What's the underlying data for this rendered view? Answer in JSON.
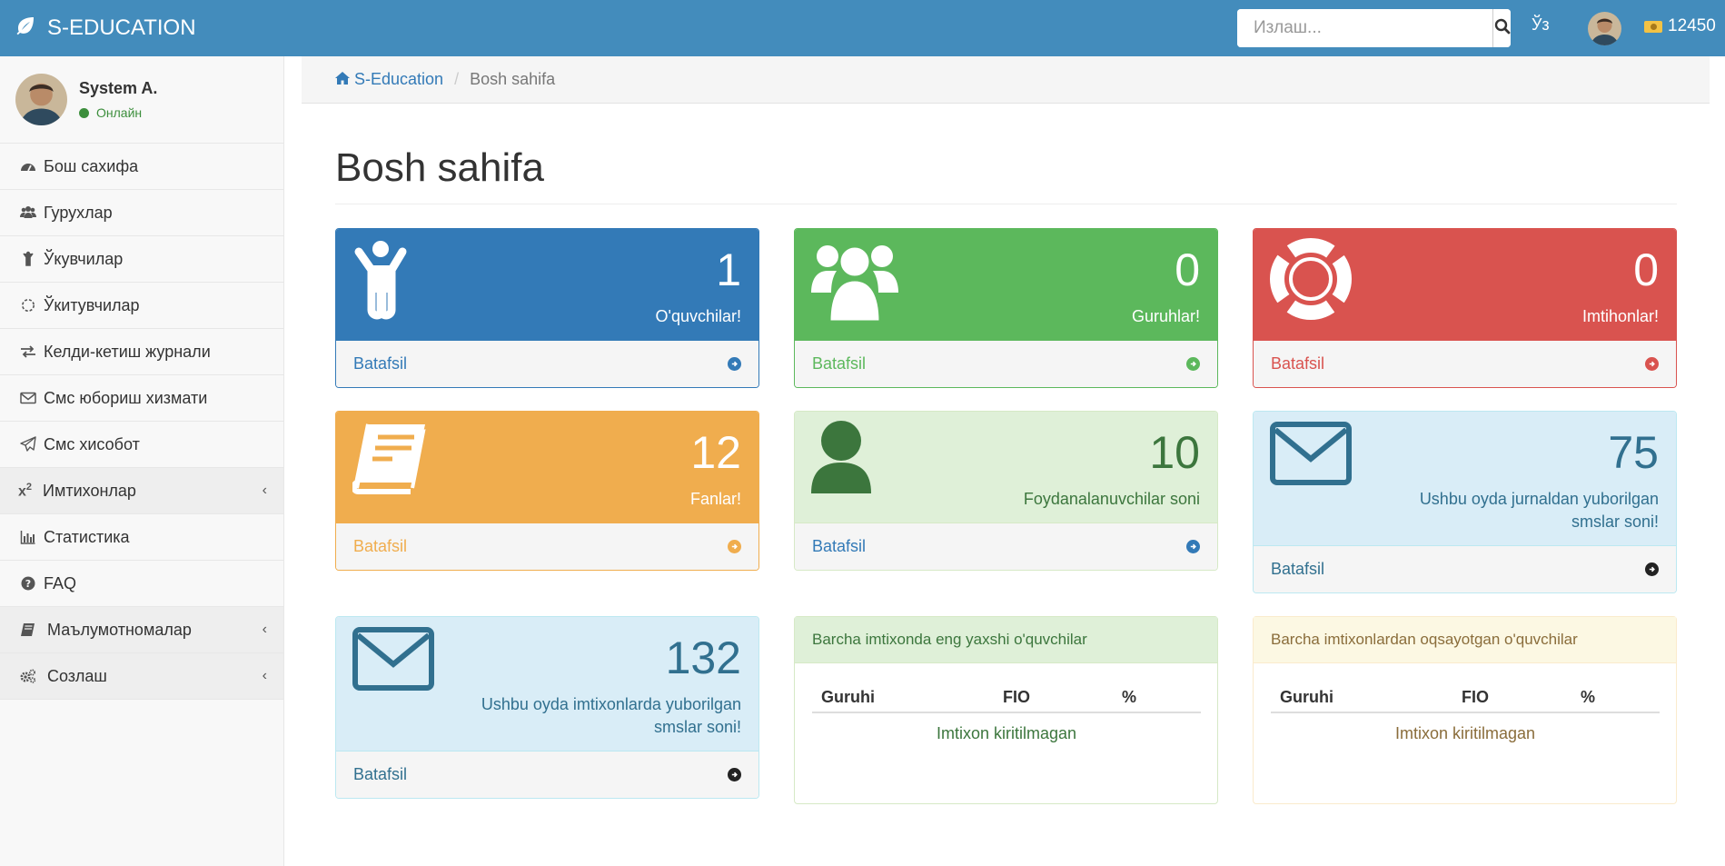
{
  "brand": {
    "name": "S-EDUCATION"
  },
  "header": {
    "search_placeholder": "Излаш...",
    "lang": "Ўз",
    "balance": "12450"
  },
  "user": {
    "name": "System A.",
    "status": "Онлайн"
  },
  "sidebar": {
    "items": [
      {
        "label": "Бош сахифа",
        "icon": "dashboard-icon"
      },
      {
        "label": "Гурухлар",
        "icon": "users-icon"
      },
      {
        "label": "Ўкувчилар",
        "icon": "child-icon"
      },
      {
        "label": "Ўкитувчилар",
        "icon": "spinner-icon"
      },
      {
        "label": "Келди-кетиш журнали",
        "icon": "exchange-icon"
      },
      {
        "label": "Смс юбориш хизмати",
        "icon": "envelope-icon"
      },
      {
        "label": "Смс хисобот",
        "icon": "paper-plane-icon"
      },
      {
        "label": "Имтихонлар",
        "icon": "superscript-icon",
        "expandable": true
      },
      {
        "label": "Статистика",
        "icon": "bar-chart-icon"
      },
      {
        "label": "FAQ",
        "icon": "question-circle-icon"
      },
      {
        "label": "Маълумотномалар",
        "icon": "book-icon",
        "expandable": true
      },
      {
        "label": "Созлаш",
        "icon": "cogs-icon",
        "expandable": true
      }
    ]
  },
  "breadcrumb": {
    "home": "S-Education",
    "current": "Bosh sahifa"
  },
  "page": {
    "title": "Bosh sahifa"
  },
  "cards": [
    {
      "value": "1",
      "label": "O'quvchilar!",
      "link": "Batafsil",
      "icon": "child-icon",
      "color": "#337ab7"
    },
    {
      "value": "0",
      "label": "Guruhlar!",
      "link": "Batafsil",
      "icon": "users-icon",
      "color": "#5cb85c"
    },
    {
      "value": "0",
      "label": "Imtihonlar!",
      "link": "Batafsil",
      "icon": "life-ring-icon",
      "color": "#d9534f"
    },
    {
      "value": "12",
      "label": "Fanlar!",
      "link": "Batafsil",
      "icon": "book-icon",
      "color": "#f0ad4e"
    },
    {
      "value": "10",
      "label": "Foydanalanuvchilar soni",
      "link": "Batafsil",
      "icon": "user-icon",
      "color": "#dff0d8"
    },
    {
      "value": "75",
      "label": "Ushbu oyda jurnaldan yuborilgan smslar soni!",
      "link": "Batafsil",
      "icon": "envelope-icon",
      "color": "#d9edf7"
    },
    {
      "value": "132",
      "label": "Ushbu oyda imtixonlarda yuborilgan smslar soni!",
      "link": "Batafsil",
      "icon": "envelope-icon",
      "color": "#d9edf7"
    }
  ],
  "tables": [
    {
      "title": "Barcha imtixonda eng yaxshi o'quvchilar",
      "columns": [
        "Guruhi",
        "FIO",
        "%"
      ],
      "empty": "Imtixon kiritilmagan"
    },
    {
      "title": "Barcha imtixonlardan oqsayotgan o'quvchilar",
      "columns": [
        "Guruhi",
        "FIO",
        "%"
      ],
      "empty": "Imtixon kiritilmagan"
    }
  ],
  "colors": {
    "navbar": "#438cbc",
    "primary": "#337ab7",
    "success": "#5cb85c",
    "danger": "#d9534f",
    "warning": "#f0ad4e"
  }
}
